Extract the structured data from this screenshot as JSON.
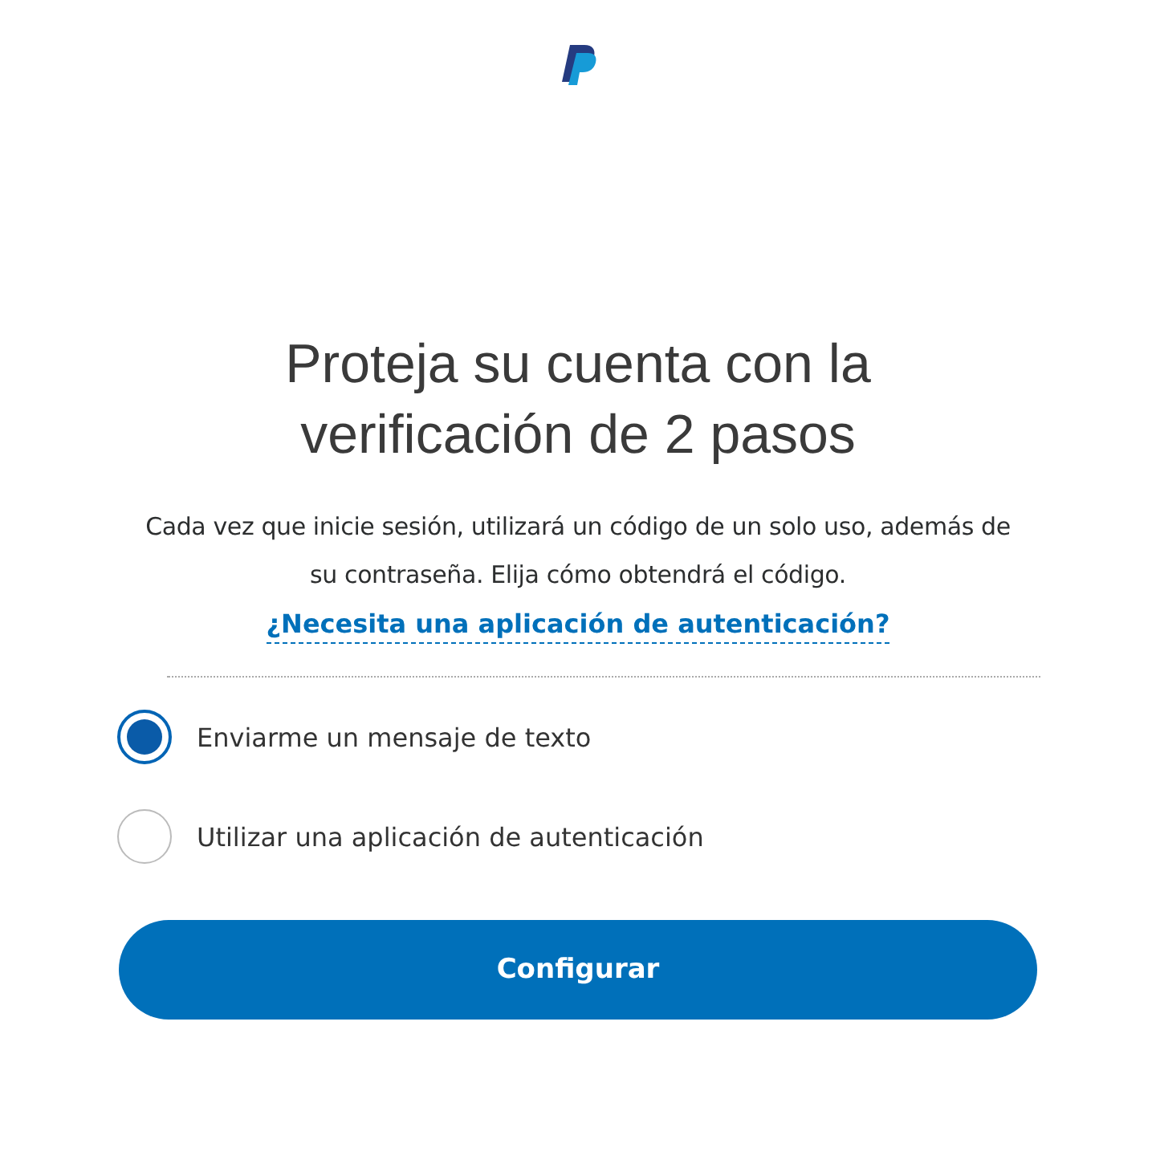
{
  "title": "Proteja su cuenta con la verificación de 2 pasos",
  "description": "Cada vez que inicie sesión, utilizará un código de un solo uso, además de su contraseña. Elija cómo obtendrá el código.",
  "help_link": "¿Necesita una aplicación de autenticación?",
  "options": [
    {
      "label": "Enviarme un mensaje de texto",
      "selected": true
    },
    {
      "label": "Utilizar una aplicación de autenticación",
      "selected": false
    }
  ],
  "button": "Configurar"
}
